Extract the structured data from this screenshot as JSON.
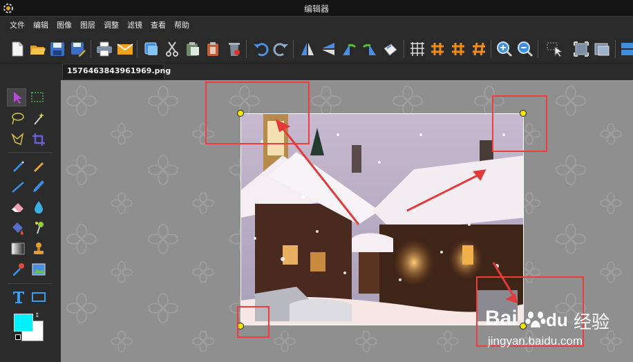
{
  "window": {
    "title": "编辑器"
  },
  "menu": [
    "文件",
    "编辑",
    "图像",
    "图层",
    "调整",
    "滤镜",
    "查看",
    "帮助"
  ],
  "toolbar": {
    "buttons": [
      "new-icon",
      "open-icon",
      "save-icon",
      "save-as-icon",
      "print-icon",
      "email-icon",
      "copy-icon",
      "cut-icon",
      "paste-icon",
      "paste-new-icon",
      "delete-icon",
      "undo-icon",
      "redo-icon",
      "flip-vertical-icon",
      "flip-horizontal-icon",
      "rotate-left-icon",
      "rotate-right-icon",
      "rotate-free-icon",
      "grid-icon",
      "grid-snap-icon",
      "guides-icon",
      "guides-snap-icon",
      "zoom-in-icon",
      "zoom-out-icon",
      "selection-icon",
      "fit-icon",
      "actual-size-icon",
      "panel-icon"
    ]
  },
  "document": {
    "tab_title": "1576463843961969.png *"
  },
  "colors": {
    "foreground": "#00f0ff",
    "background": "#ffffff",
    "annotation": "#f23c3c",
    "handle": "#f1e50b"
  },
  "watermark": {
    "brand": "Bai",
    "brand2": "du",
    "suffix": "经验",
    "url": "jingyan.baidu.com"
  }
}
